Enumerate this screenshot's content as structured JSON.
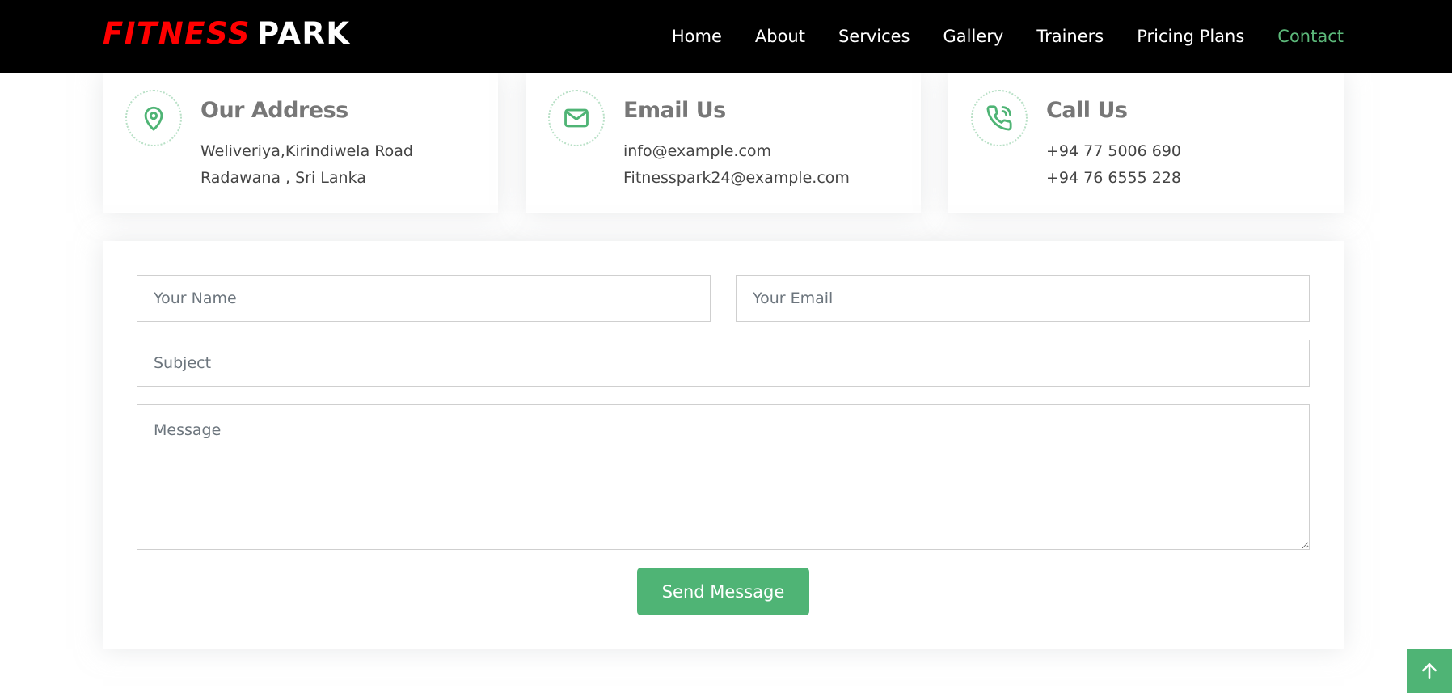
{
  "header": {
    "logo_part1": "FITNESS",
    "logo_part2": "PARK",
    "nav": [
      {
        "label": "Home"
      },
      {
        "label": "About"
      },
      {
        "label": "Services"
      },
      {
        "label": "Gallery"
      },
      {
        "label": "Trainers"
      },
      {
        "label": "Pricing Plans"
      },
      {
        "label": "Contact",
        "active": true
      }
    ]
  },
  "info_cards": [
    {
      "icon": "map-pin-icon",
      "title": "Our Address",
      "line1": "Weliveriya,Kirindiwela Road",
      "line2": "Radawana , Sri Lanka"
    },
    {
      "icon": "envelope-icon",
      "title": "Email Us",
      "line1": "info@example.com",
      "line2": "Fitnesspark24@example.com"
    },
    {
      "icon": "phone-icon",
      "title": "Call Us",
      "line1": "+94 77 5006 690",
      "line2": "+94 76 6555 228"
    }
  ],
  "form": {
    "name_placeholder": "Your Name",
    "email_placeholder": "Your Email",
    "subject_placeholder": "Subject",
    "message_placeholder": "Message",
    "submit_label": "Send Message"
  },
  "back_to_top": {
    "icon": "arrow-up-icon"
  },
  "colors": {
    "accent": "#4fb475",
    "nav_active": "#5cb97a",
    "logo_red": "#ff0000",
    "header_bg": "#000000"
  }
}
